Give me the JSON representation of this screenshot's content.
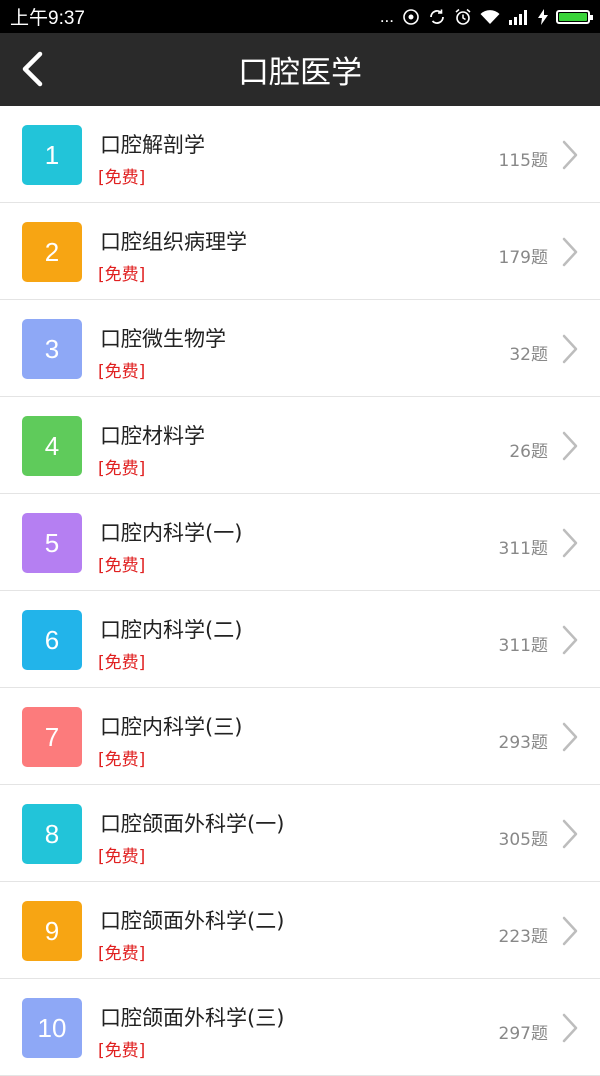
{
  "status_bar": {
    "time": "上午9:37",
    "signal_text": "..."
  },
  "header": {
    "title": "口腔医学"
  },
  "items": [
    {
      "num": "1",
      "name": "口腔解剖学",
      "tag": "[免费]",
      "count": "115题",
      "color": "#22c4d9"
    },
    {
      "num": "2",
      "name": "口腔组织病理学",
      "tag": "[免费]",
      "count": "179题",
      "color": "#f7a513"
    },
    {
      "num": "3",
      "name": "口腔微生物学",
      "tag": "[免费]",
      "count": "32题",
      "color": "#8ea8f6"
    },
    {
      "num": "4",
      "name": "口腔材料学",
      "tag": "[免费]",
      "count": "26题",
      "color": "#5fcb5b"
    },
    {
      "num": "5",
      "name": "口腔内科学(一)",
      "tag": "[免费]",
      "count": "311题",
      "color": "#b57ff2"
    },
    {
      "num": "6",
      "name": "口腔内科学(二)",
      "tag": "[免费]",
      "count": "311题",
      "color": "#22b4ea"
    },
    {
      "num": "7",
      "name": "口腔内科学(三)",
      "tag": "[免费]",
      "count": "293题",
      "color": "#fc7b7c"
    },
    {
      "num": "8",
      "name": "口腔颌面外科学(一)",
      "tag": "[免费]",
      "count": "305题",
      "color": "#22c4d9"
    },
    {
      "num": "9",
      "name": "口腔颌面外科学(二)",
      "tag": "[免费]",
      "count": "223题",
      "color": "#f7a513"
    },
    {
      "num": "10",
      "name": "口腔颌面外科学(三)",
      "tag": "[免费]",
      "count": "297题",
      "color": "#8ea8f6"
    }
  ],
  "battery_level": 1.0
}
